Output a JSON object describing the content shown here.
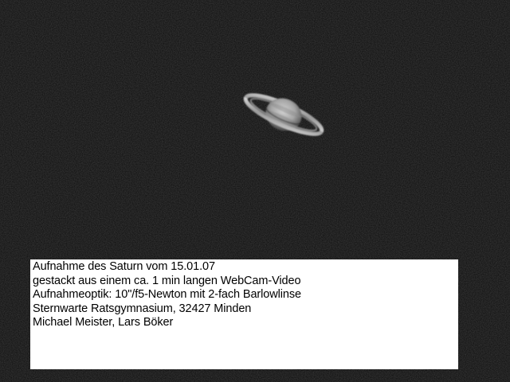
{
  "image": {
    "subject": "saturn",
    "background_color": "#0b0b0b",
    "caption_background": "#ffffff",
    "caption_text_color": "#000000"
  },
  "caption": {
    "lines": [
      "Aufnahme des Saturn vom 15.01.07",
      "gestackt aus einem ca. 1 min langen WebCam-Video",
      "Aufnahmeoptik: 10\"/f5-Newton mit 2-fach Barlowlinse",
      "Sternwarte Ratsgymnasium, 32427 Minden",
      "Michael Meister, Lars Böker"
    ]
  }
}
